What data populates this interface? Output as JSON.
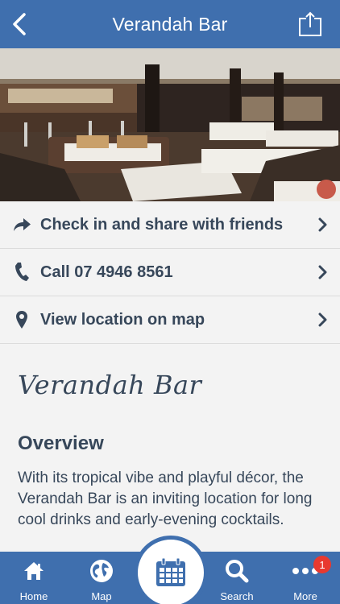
{
  "header": {
    "title": "Verandah Bar"
  },
  "actions": [
    {
      "label": "Check in and share with friends",
      "icon": "share-arrow-icon"
    },
    {
      "label": "Call 07 4946 8561",
      "icon": "phone-icon"
    },
    {
      "label": "View location on map",
      "icon": "map-pin-icon"
    }
  ],
  "content": {
    "script_title": "Verandah Bar",
    "heading": "Overview",
    "body": "With its tropical vibe and playful décor, the Verandah Bar is an inviting location for long cool drinks and early-evening cocktails."
  },
  "tabbar": {
    "home": "Home",
    "map": "Map",
    "search": "Search",
    "more": "More",
    "more_badge": "1"
  },
  "colors": {
    "brand": "#3f6fae",
    "text": "#37475a",
    "badge": "#e8392f"
  }
}
